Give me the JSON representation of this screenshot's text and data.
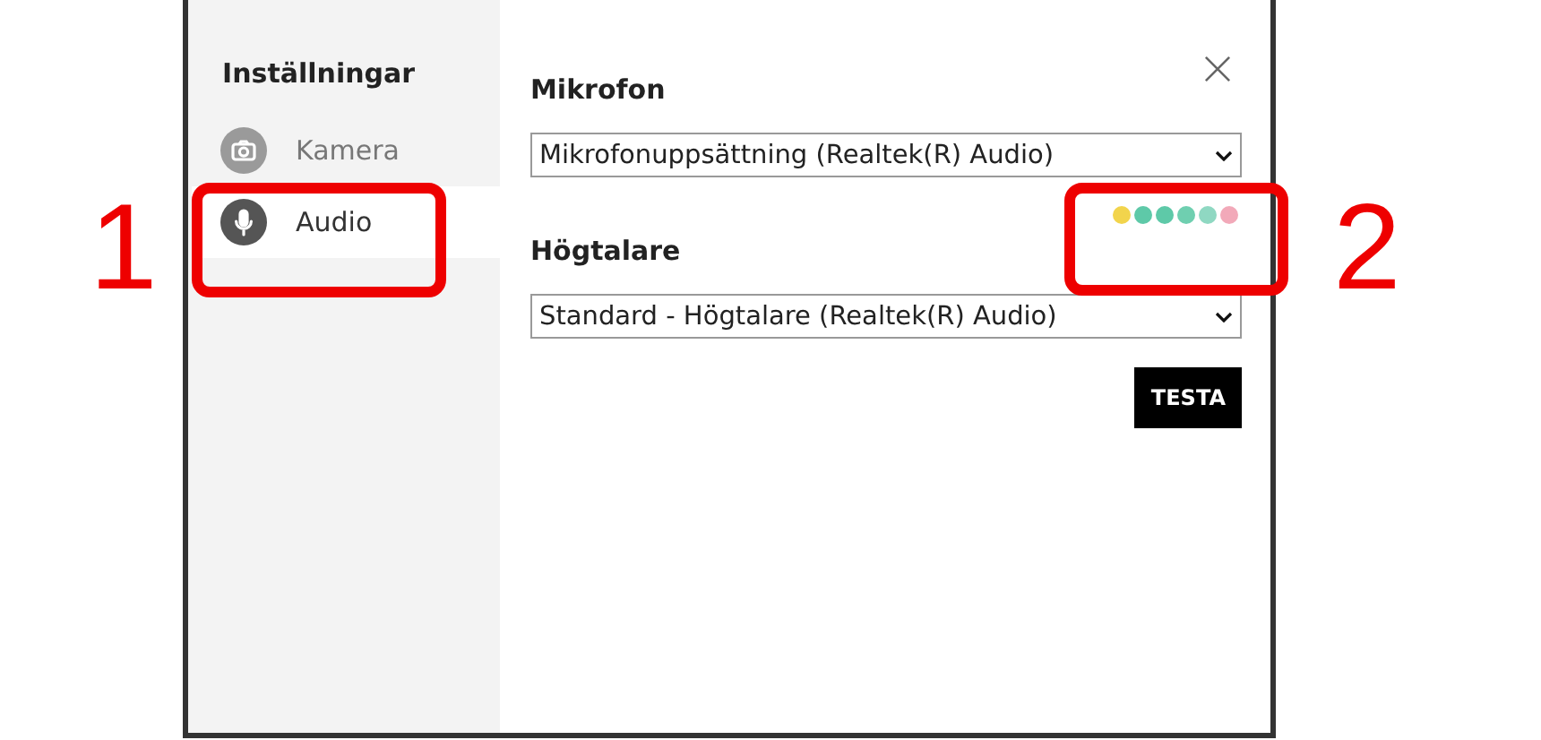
{
  "sidebar": {
    "title": "Inställningar",
    "items": [
      {
        "label": "Kamera",
        "kind": "camera",
        "selected": false
      },
      {
        "label": "Audio",
        "kind": "microphone",
        "selected": true
      }
    ]
  },
  "microphone": {
    "label": "Mikrofon",
    "value": "Mikrofonuppsättning (Realtek(R) Audio)",
    "meter": [
      {
        "color": "#f2d44c"
      },
      {
        "color": "#5ec9a8"
      },
      {
        "color": "#5ec9a8"
      },
      {
        "color": "#6fcfb0"
      },
      {
        "color": "#8fd8c2"
      },
      {
        "color": "#f2a9b9"
      }
    ]
  },
  "speaker": {
    "label": "Högtalare",
    "value": "Standard - Högtalare (Realtek(R) Audio)"
  },
  "buttons": [
    {
      "label": "TESTA"
    }
  ],
  "annotations": [
    {
      "label": "1"
    },
    {
      "label": "2"
    }
  ]
}
